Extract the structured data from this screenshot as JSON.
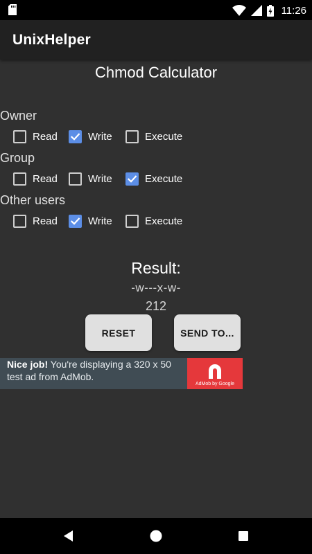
{
  "status_bar": {
    "time": "11:26",
    "icons": [
      "sd-card-icon",
      "wifi-icon",
      "signal-icon",
      "battery-charging-icon"
    ]
  },
  "app_bar": {
    "title": "UnixHelper"
  },
  "main": {
    "heading": "Chmod Calculator",
    "groups": [
      {
        "label": "Owner",
        "options": [
          {
            "label": "Read",
            "checked": false
          },
          {
            "label": "Write",
            "checked": true
          },
          {
            "label": "Execute",
            "checked": false
          }
        ]
      },
      {
        "label": "Group",
        "options": [
          {
            "label": "Read",
            "checked": false
          },
          {
            "label": "Write",
            "checked": false
          },
          {
            "label": "Execute",
            "checked": true
          }
        ]
      },
      {
        "label": "Other users",
        "options": [
          {
            "label": "Read",
            "checked": false
          },
          {
            "label": "Write",
            "checked": true
          },
          {
            "label": "Execute",
            "checked": false
          }
        ]
      }
    ],
    "result_title": "Result:",
    "result_symbolic": "-w---x-w-",
    "result_octal": "212",
    "reset_label": "RESET",
    "send_label": "SEND TO..."
  },
  "ad": {
    "bold_text": "Nice job!",
    "text": " You're displaying a 320 x 50 test ad from AdMob.",
    "logo_text": "AdMob by Google"
  },
  "nav_bar": {
    "icons": [
      "back-icon",
      "home-icon",
      "recents-icon"
    ]
  },
  "colors": {
    "background": "#303030",
    "app_bar": "#212121",
    "checkbox_accent": "#5c8ee6",
    "button": "#e0e0e0",
    "ad_background": "#404c54",
    "ad_logo": "#e5383b"
  }
}
